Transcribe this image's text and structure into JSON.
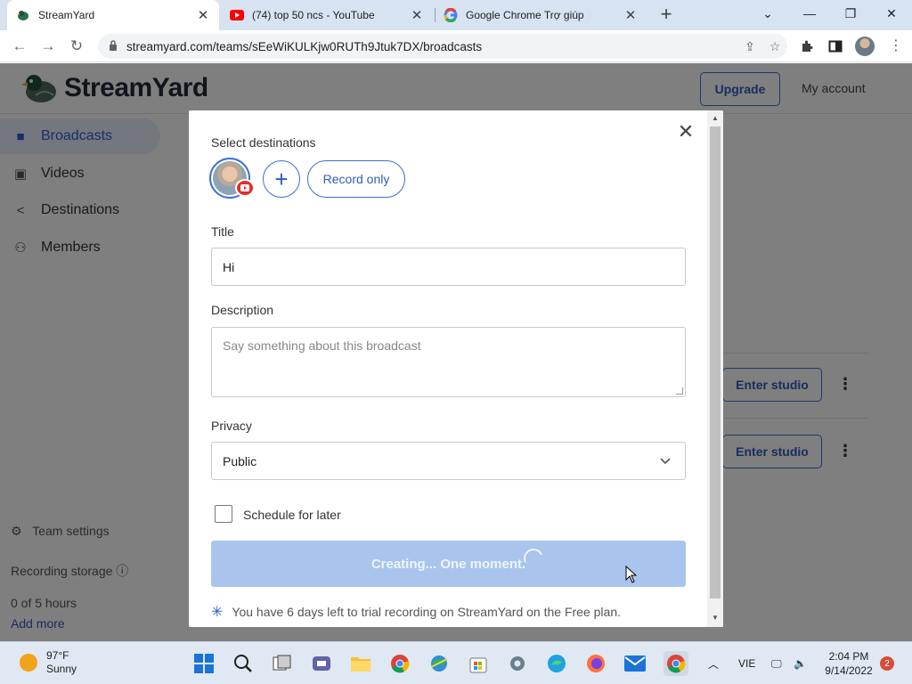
{
  "browser": {
    "tabs": [
      {
        "title": "StreamYard",
        "active": true
      },
      {
        "title": "(74) top 50 ncs - YouTube",
        "active": false
      },
      {
        "title": "Google Chrome Trợ giúp",
        "active": false
      }
    ],
    "url": "streamyard.com/teams/sEeWiKULKjw0RUTh9Jtuk7DX/broadcasts"
  },
  "header": {
    "logo_text": "StreamYard",
    "upgrade_label": "Upgrade",
    "account_label": "My account"
  },
  "sidebar": {
    "items": [
      {
        "label": "Broadcasts",
        "icon": "video-camera-icon",
        "active": true
      },
      {
        "label": "Videos",
        "icon": "video-library-icon",
        "active": false
      },
      {
        "label": "Destinations",
        "icon": "share-icon",
        "active": false
      },
      {
        "label": "Members",
        "icon": "people-icon",
        "active": false
      }
    ],
    "team_settings": "Team settings",
    "recording_storage": "Recording storage",
    "storage_used": "0 of 5 hours",
    "add_more": "Add more"
  },
  "broadcast_rows": [
    {
      "button": "Enter studio"
    },
    {
      "button": "Enter studio"
    }
  ],
  "modal": {
    "destinations_label": "Select destinations",
    "record_only_label": "Record only",
    "title_label": "Title",
    "title_value": "Hi",
    "description_label": "Description",
    "description_placeholder": "Say something about this broadcast",
    "privacy_label": "Privacy",
    "privacy_value": "Public",
    "schedule_label": "Schedule for later",
    "schedule_checked": false,
    "submit_label": "Creating... One moment.",
    "trial_notice": "You have 6 days left to trial recording on StreamYard on the Free plan."
  },
  "taskbar": {
    "weather_temp": "97°F",
    "weather_desc": "Sunny",
    "language": "VIE",
    "time": "2:04 PM",
    "date": "9/14/2022",
    "notification_count": "2"
  },
  "colors": {
    "accent": "#2d5cbf",
    "button_loading": "#a9c5ee",
    "youtube_red": "#e52d27"
  }
}
